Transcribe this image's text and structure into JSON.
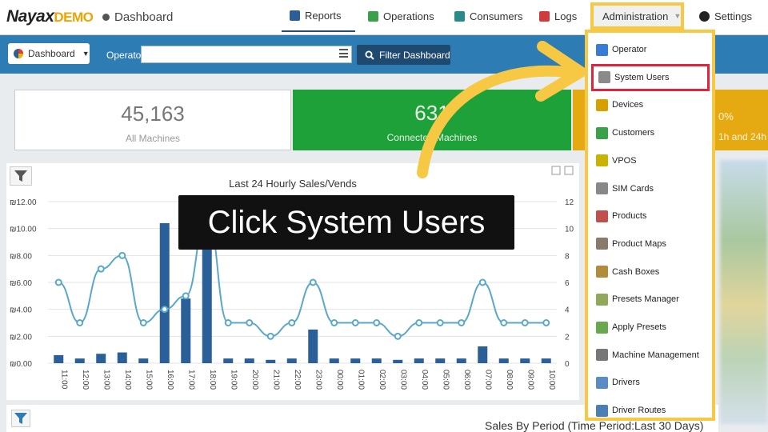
{
  "brand": {
    "name": "Nayax",
    "suffix": "DEMO"
  },
  "breadcrumb": "Dashboard",
  "nav": {
    "reports": "Reports",
    "operations": "Operations",
    "consumers": "Consumers",
    "logs": "Logs",
    "administration": "Administration",
    "settings": "Settings"
  },
  "toolbar": {
    "dashboard_select": "Dashboard",
    "operator_label": "Operator",
    "operator_value": "",
    "filter_button": "Filter Dashboard"
  },
  "cards": [
    {
      "value": "45,163",
      "label": "All Machines"
    },
    {
      "value": "631",
      "label": "Connected Machines"
    },
    {
      "value": "0%",
      "label": "1h and 24h"
    }
  ],
  "chart_data": {
    "type": "bar",
    "title": "Last 24 Hourly Sales/Vends",
    "categories": [
      "11:00",
      "12:00",
      "13:00",
      "14:00",
      "15:00",
      "16:00",
      "17:00",
      "18:00",
      "19:00",
      "20:00",
      "21:00",
      "22:00",
      "23:00",
      "00:00",
      "01:00",
      "02:00",
      "03:00",
      "04:00",
      "05:00",
      "06:00",
      "07:00",
      "08:00",
      "09:00",
      "10:00"
    ],
    "series": [
      {
        "values": [
          0.6,
          0.35,
          0.7,
          0.8,
          0.35,
          10.4,
          4.8,
          10.6,
          0.35,
          0.35,
          0.25,
          0.35,
          2.5,
          0.35,
          0.35,
          0.35,
          0.25,
          0.35,
          0.35,
          0.35,
          1.25,
          0.35,
          0.35,
          0.35
        ]
      },
      {
        "values": [
          6,
          3,
          7,
          8,
          3,
          4,
          5,
          11,
          3,
          3,
          2,
          3,
          6,
          3,
          3,
          3,
          2,
          3,
          3,
          3,
          6,
          3,
          3,
          3
        ]
      }
    ],
    "y_left_ticks": [
      "₪0.00",
      "₪2.00",
      "₪4.00",
      "₪6.00",
      "₪8.00",
      "₪10.00",
      "₪12.00"
    ],
    "y_right_ticks": [
      "0",
      "2",
      "4",
      "6",
      "8",
      "10",
      "12"
    ],
    "ylim": [
      0,
      12
    ],
    "grid": true,
    "colors": {
      "bar": "#2b5f97",
      "line": "#5aa8c8"
    }
  },
  "period_title": "Sales By Period (Time Period:Last 30 Days)",
  "admin_menu": [
    {
      "label": "Operator",
      "icon": "org-chart-icon",
      "color": "#3a7bd5"
    },
    {
      "label": "System Users",
      "icon": "user-icon",
      "color": "#8a8a8a",
      "highlight": true
    },
    {
      "label": "Devices",
      "icon": "device-icon",
      "color": "#d6a000"
    },
    {
      "label": "Customers",
      "icon": "customer-icon",
      "color": "#3aa04a"
    },
    {
      "label": "VPOS",
      "icon": "vpos-icon",
      "color": "#c8b400"
    },
    {
      "label": "SIM Cards",
      "icon": "sim-card-icon",
      "color": "#888888"
    },
    {
      "label": "Products",
      "icon": "products-icon",
      "color": "#c0504d"
    },
    {
      "label": "Product Maps",
      "icon": "product-map-icon",
      "color": "#8a7a6a"
    },
    {
      "label": "Cash Boxes",
      "icon": "cash-box-icon",
      "color": "#b08d3c"
    },
    {
      "label": "Presets Manager",
      "icon": "presets-manager-icon",
      "color": "#8fa85a"
    },
    {
      "label": "Apply Presets",
      "icon": "apply-presets-icon",
      "color": "#6aa84f"
    },
    {
      "label": "Machine Management",
      "icon": "machine-management-icon",
      "color": "#777777"
    },
    {
      "label": "Drivers",
      "icon": "drivers-icon",
      "color": "#5b8bc5"
    },
    {
      "label": "Driver Routes",
      "icon": "driver-routes-icon",
      "color": "#4a7fb5"
    }
  ],
  "overlay": {
    "instruction": "Click System Users",
    "accent": "#f7c843"
  }
}
